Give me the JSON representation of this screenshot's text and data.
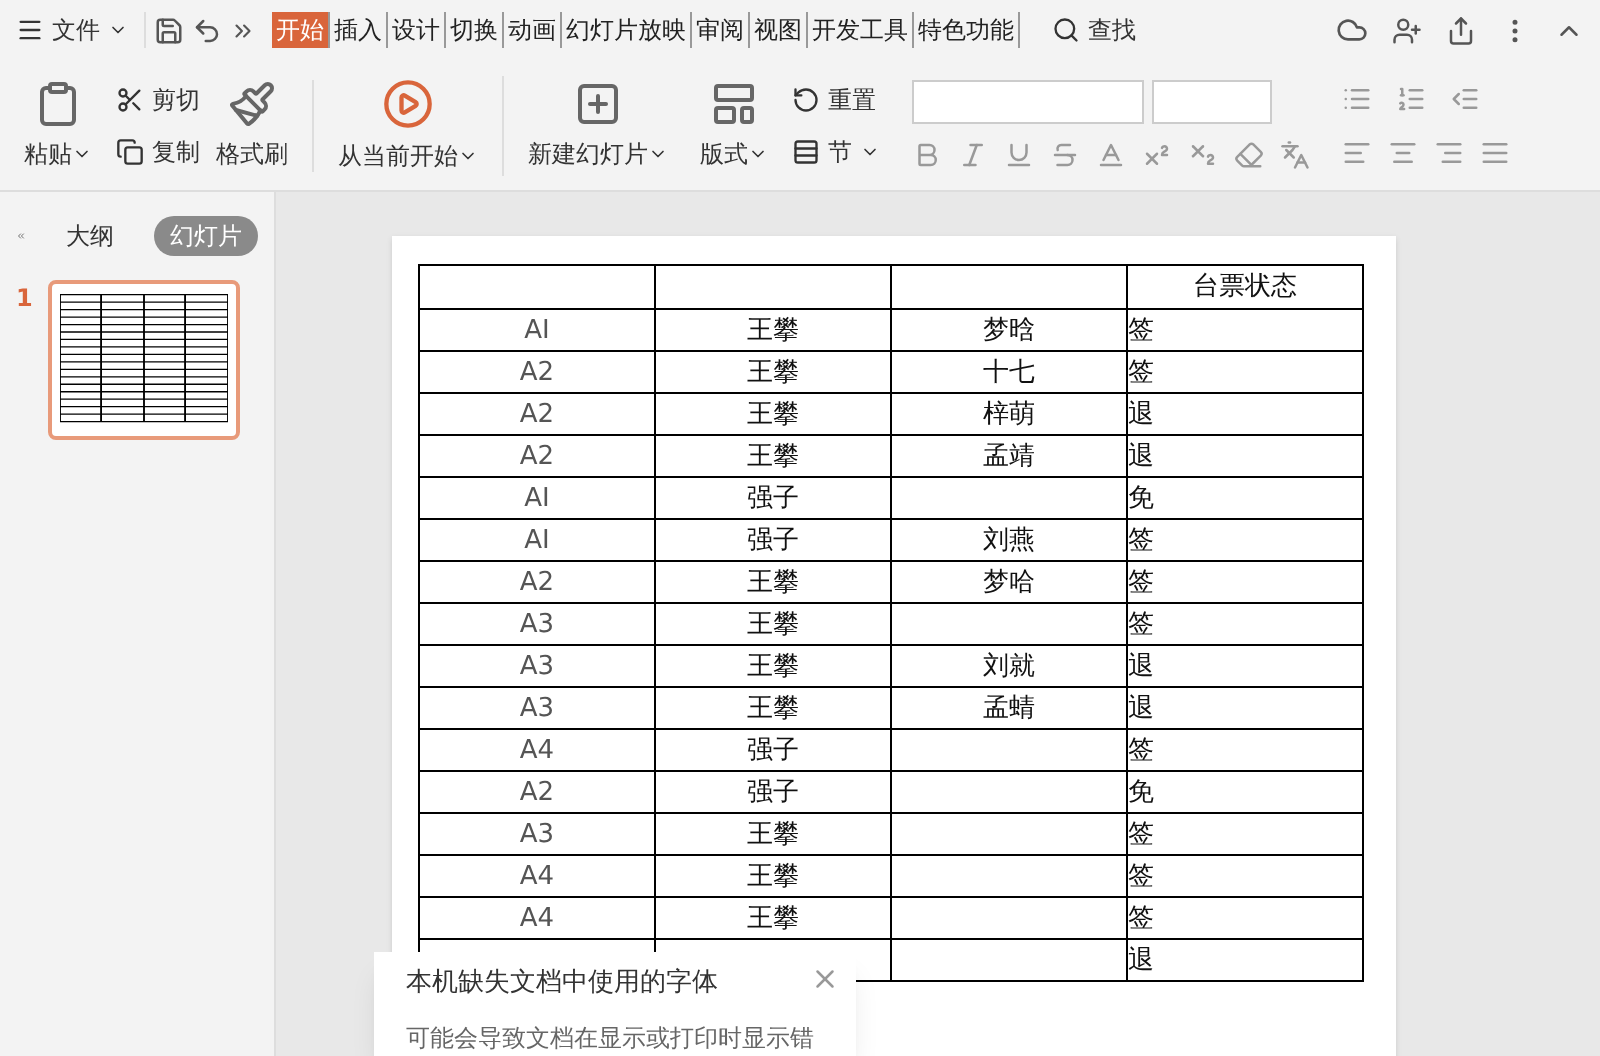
{
  "menu_bar": {
    "file_menu": "文件",
    "tabs": [
      {
        "label": "开始",
        "selected": true
      },
      {
        "label": "插入",
        "selected": false
      },
      {
        "label": "设计",
        "selected": false
      },
      {
        "label": "切换",
        "selected": false
      },
      {
        "label": "动画",
        "selected": false
      },
      {
        "label": "幻灯片放映",
        "selected": false
      },
      {
        "label": "审阅",
        "selected": false
      },
      {
        "label": "视图",
        "selected": false
      },
      {
        "label": "开发工具",
        "selected": false
      },
      {
        "label": "特色功能",
        "selected": false
      }
    ],
    "search": "查找"
  },
  "ribbon": {
    "paste": "粘贴",
    "cut": "剪切",
    "copy": "复制",
    "format_painter": "格式刷",
    "play_from_current": "从当前开始",
    "new_slide": "新建幻灯片",
    "layout": "版式",
    "reset": "重置",
    "section": "节"
  },
  "sidebar": {
    "tabs": [
      {
        "label": "大纲",
        "selected": false
      },
      {
        "label": "幻灯片",
        "selected": true
      }
    ],
    "slides": [
      {
        "number": "1",
        "selected": true
      }
    ]
  },
  "slide": {
    "table": {
      "columns": [
        "",
        "",
        "",
        "台票状态"
      ],
      "rows": [
        {
          "column_1": "AI",
          "column_2": "王攀",
          "column_3": "梦晗",
          "column_4": "签"
        },
        {
          "column_1": "A2",
          "column_2": "王攀",
          "column_3": "十七",
          "column_4": "签"
        },
        {
          "column_1": "A2",
          "column_2": "王攀",
          "column_3": "梓萌",
          "column_4": "退"
        },
        {
          "column_1": "A2",
          "column_2": "王攀",
          "column_3": "孟靖",
          "column_4": "退"
        },
        {
          "column_1": "AI",
          "column_2": "强子",
          "column_4": "免"
        },
        {
          "column_1": "AI",
          "column_2": "强子",
          "column_3": "刘燕",
          "column_4": "签"
        },
        {
          "column_1": "A2",
          "column_2": "王攀",
          "column_3": "梦哈",
          "column_4": "签"
        },
        {
          "column_1": "A3",
          "column_2": "王攀",
          "column_4": "签"
        },
        {
          "column_1": "A3",
          "column_2": "王攀",
          "column_3": "刘就",
          "column_4": "退"
        },
        {
          "column_1": "A3",
          "column_2": "王攀",
          "column_3": "孟蜻",
          "column_4": "退"
        },
        {
          "column_1": "A4",
          "column_2": "强子",
          "column_4": "签"
        },
        {
          "column_1": "A2",
          "column_2": "强子",
          "column_4": "免"
        },
        {
          "column_1": "A3",
          "column_2": "王攀",
          "column_4": "签"
        },
        {
          "column_1": "A4",
          "column_2": "王攀",
          "column_4": "签"
        },
        {
          "column_1": "A4",
          "column_2": "王攀",
          "column_4": "签"
        },
        {
          "column_4": "退"
        }
      ]
    }
  },
  "notification": {
    "title": "本机缺失文档中使用的字体",
    "message": "可能会导致文档在显示或打印时显示错"
  }
}
